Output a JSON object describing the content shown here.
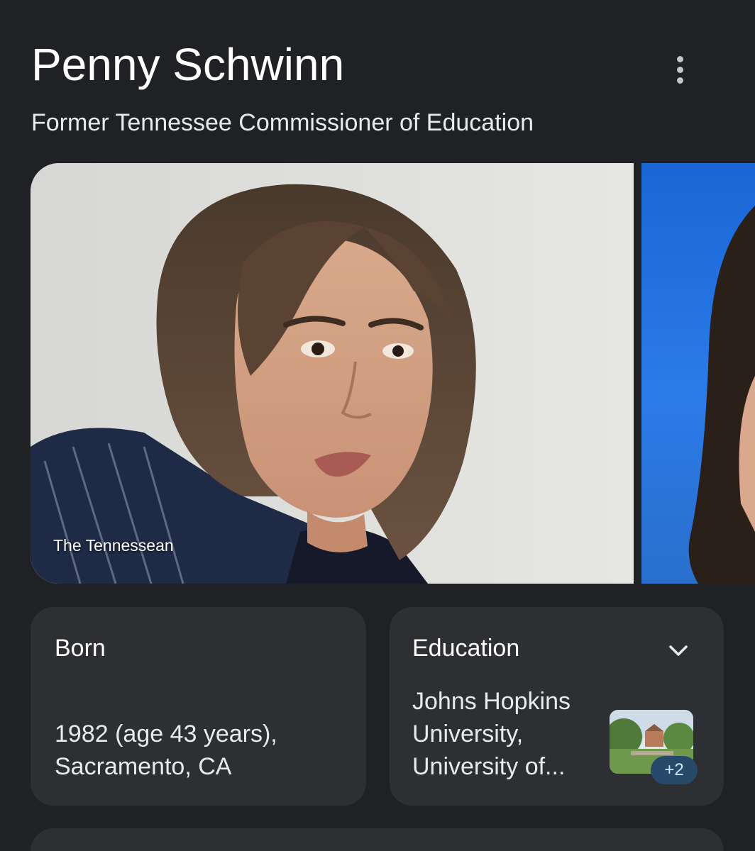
{
  "header": {
    "title": "Penny Schwinn",
    "subtitle": "Former Tennessee Commissioner of Education",
    "more_icon": "more-vert-icon"
  },
  "images": [
    {
      "caption": "The Tennessean"
    },
    {
      "caption": ""
    }
  ],
  "facts": {
    "born": {
      "label": "Born",
      "line1": "1982 (age 43 years),",
      "line2": "Sacramento, CA"
    },
    "education": {
      "label": "Education",
      "line1": "Johns Hopkins",
      "line2": "University,",
      "line3": "University of...",
      "badge": "+2",
      "expand_icon": "chevron-down-icon"
    }
  },
  "colors": {
    "background": "#202124",
    "card": "#2d2f33",
    "badge_bg": "#284a6a",
    "badge_text": "#d3e3fd"
  }
}
